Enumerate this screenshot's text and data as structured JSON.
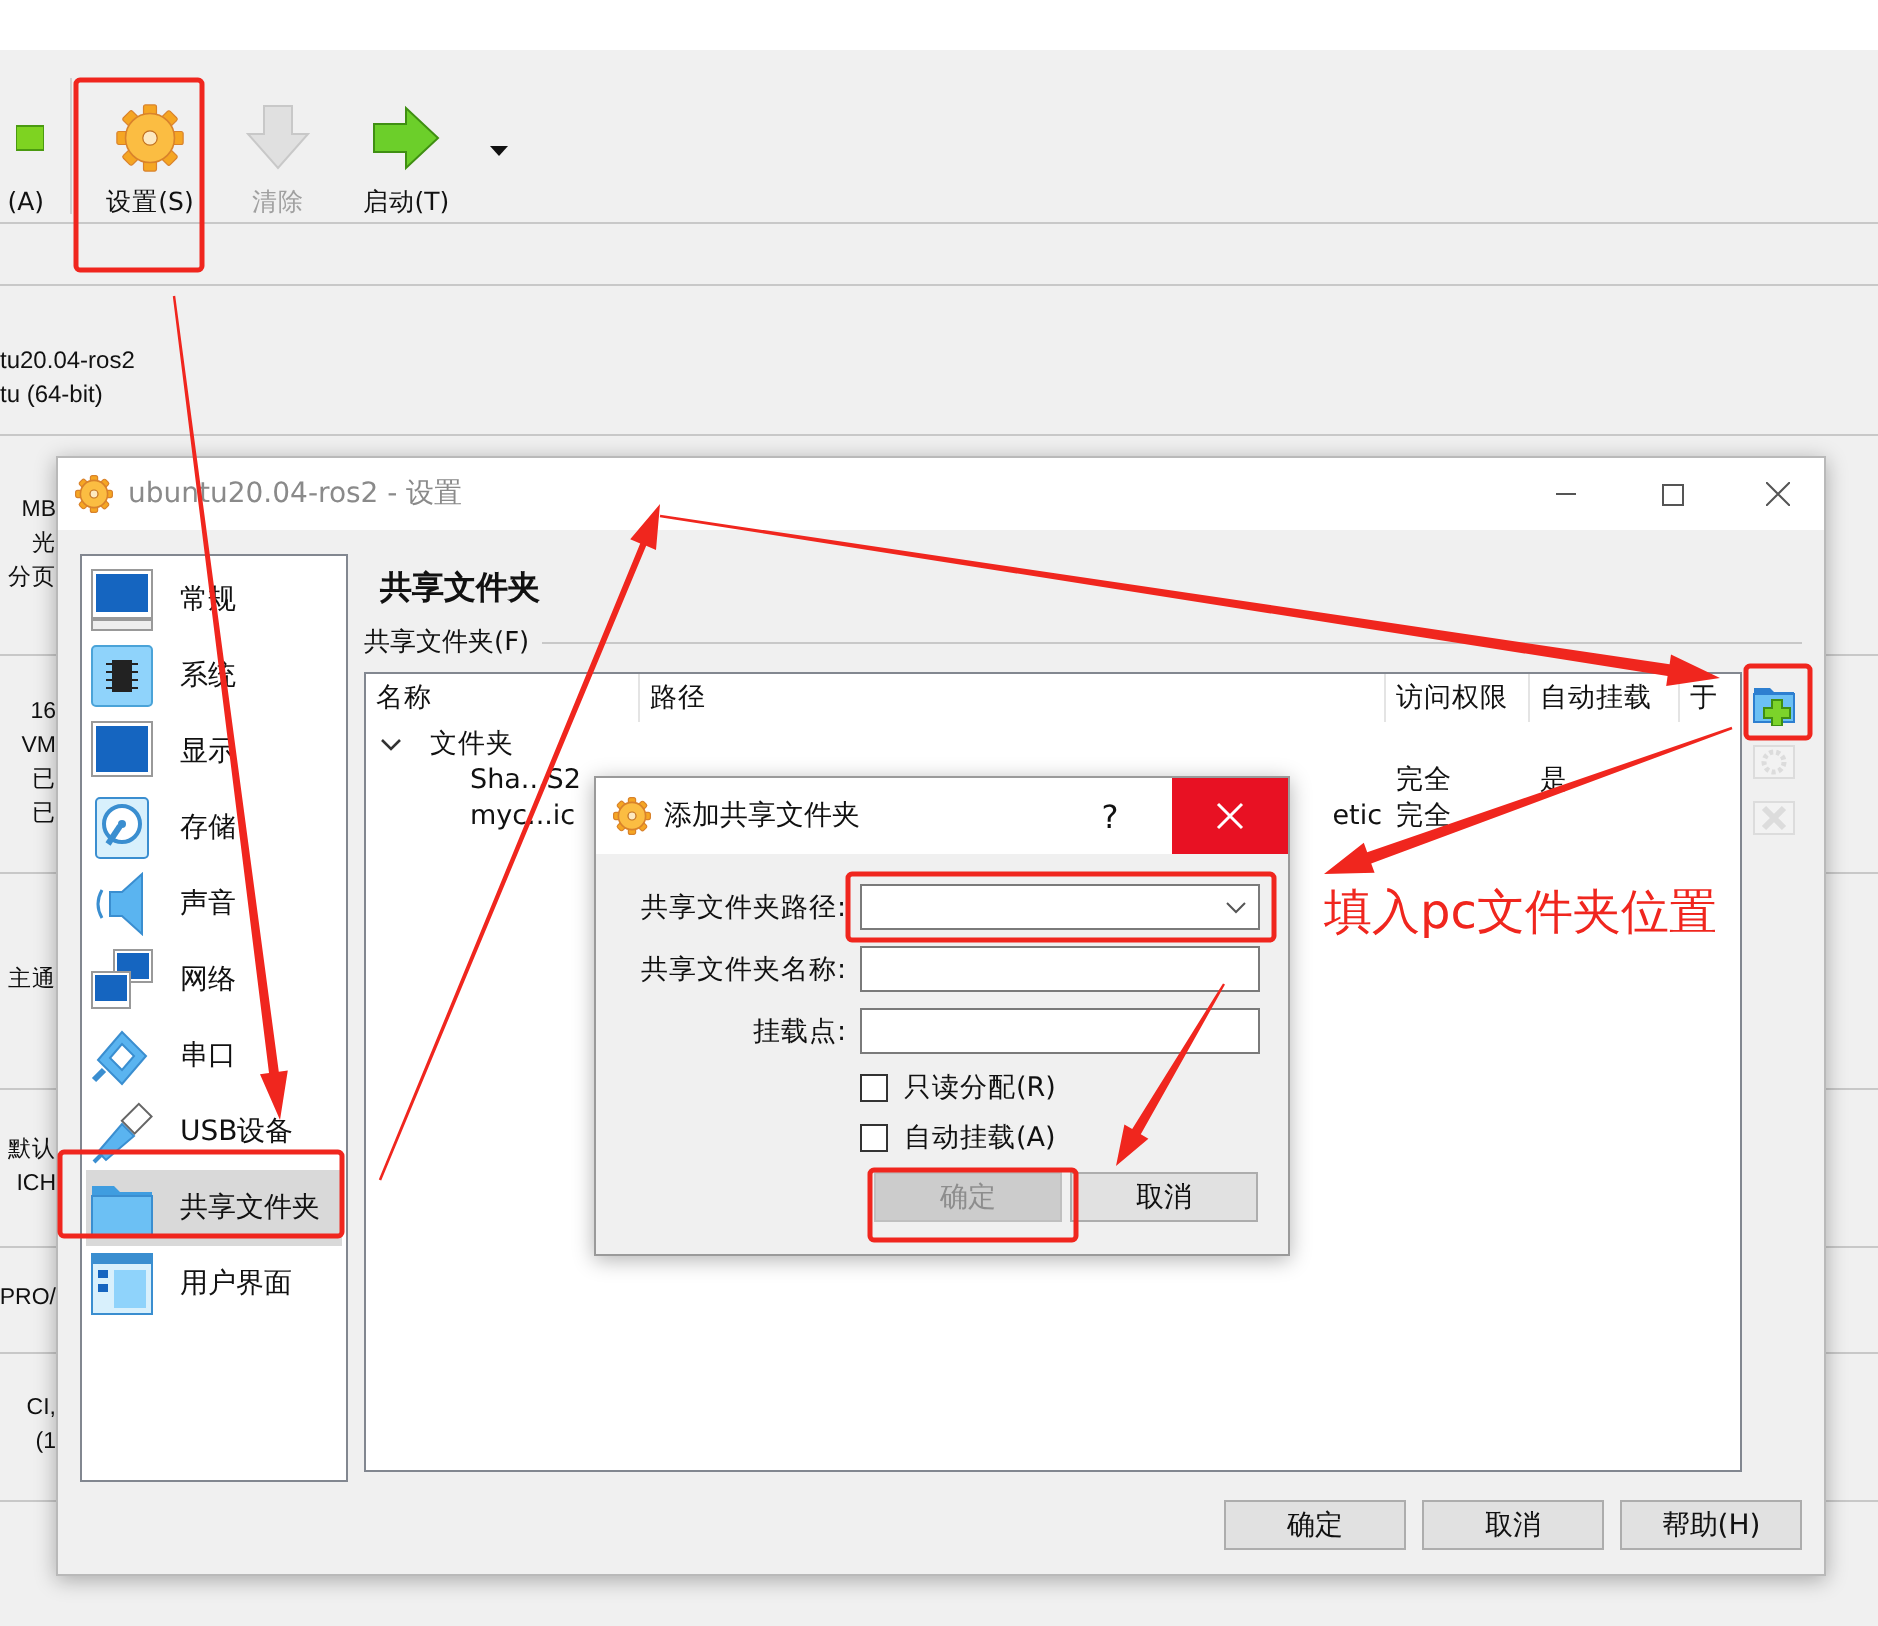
{
  "manager": {
    "toolbar": [
      {
        "label": "(A)",
        "disabled": false
      },
      {
        "label": "设置(S)",
        "disabled": false
      },
      {
        "label": "清除",
        "disabled": true
      },
      {
        "label": "启动(T)",
        "disabled": false
      }
    ],
    "details": [
      {
        "lines": [
          "tu20.04-ros2",
          "tu (64-bit)"
        ]
      },
      {
        "lines": [
          "MB",
          "光",
          "分页"
        ]
      },
      {
        "lines": [
          "16",
          "VM",
          "已",
          "已"
        ]
      },
      {
        "lines": [
          "主通"
        ]
      },
      {
        "lines": [
          "默认",
          "ICH"
        ]
      },
      {
        "lines": [
          "PRO/"
        ]
      },
      {
        "lines": [
          "CI,",
          "(1"
        ]
      }
    ]
  },
  "settings": {
    "title": "ubuntu20.04-ros2 - 设置",
    "categories": [
      {
        "label": "常规",
        "selected": false
      },
      {
        "label": "系统",
        "selected": false
      },
      {
        "label": "显示",
        "selected": false
      },
      {
        "label": "存储",
        "selected": false
      },
      {
        "label": "声音",
        "selected": false
      },
      {
        "label": "网络",
        "selected": false
      },
      {
        "label": "串口",
        "selected": false
      },
      {
        "label": "USB设备",
        "selected": false
      },
      {
        "label": "共享文件夹",
        "selected": true
      },
      {
        "label": "用户界面",
        "selected": false
      }
    ],
    "page_title": "共享文件夹",
    "group_label": "共享文件夹(F)",
    "table": {
      "columns": [
        "名称",
        "路径",
        "访问权限",
        "自动挂载",
        "于"
      ],
      "groups": [
        {
          "label": "文件夹",
          "expanded": true,
          "children": [
            {
              "name": "Sha...S2",
              "access": "完全",
              "auto_mount": "是"
            },
            {
              "name": "myc...ic",
              "path": "etic",
              "access": "完全"
            }
          ]
        }
      ]
    },
    "side_tools": [
      {
        "kind": "add",
        "disabled": false
      },
      {
        "kind": "edit",
        "disabled": true
      },
      {
        "kind": "remove",
        "disabled": true
      }
    ],
    "buttons": [
      "确定",
      "取消",
      "帮助(H)"
    ]
  },
  "dialog": {
    "title": "添加共享文件夹",
    "help": "?",
    "fields": [
      {
        "kind": "combo",
        "label": "共享文件夹路径:"
      },
      {
        "kind": "text",
        "label": "共享文件夹名称:"
      },
      {
        "kind": "text",
        "label": "挂载点:"
      }
    ],
    "checkboxes": [
      {
        "label": "只读分配(R)",
        "checked": false
      },
      {
        "label": "自动挂载(A)",
        "checked": false
      }
    ],
    "buttons": [
      {
        "label": "确定",
        "disabled": true
      },
      {
        "label": "取消",
        "disabled": false
      }
    ]
  },
  "annotation": {
    "note": "填入pc文件夹位置"
  }
}
